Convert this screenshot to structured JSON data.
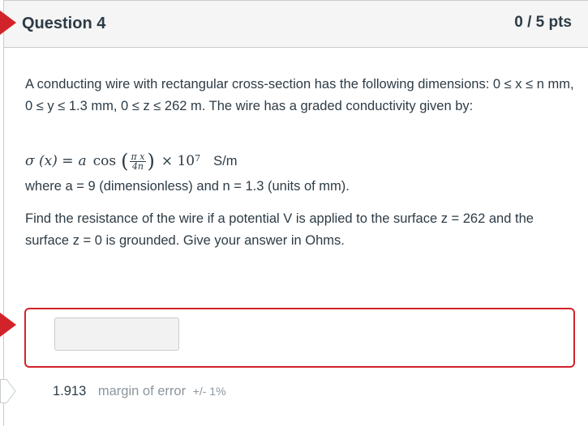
{
  "question": {
    "title": "Question 4",
    "points": "0 / 5 pts",
    "paragraph1": "A conducting wire with rectangular cross-section has the following dimensions: 0 ≤ x ≤ n mm, 0 ≤ y ≤ 1.3 mm, 0 ≤ z ≤ 262 m. The wire has a graded conductivity given by:",
    "formula": {
      "lhs": "σ (x) = ",
      "a": "a",
      "cos": "cos",
      "num": "π x",
      "den": "4n",
      "times": "× 10",
      "exp": "7",
      "unit": "S/m"
    },
    "paragraph2": "where a = 9 (dimensionless) and n = 1.3 (units of mm).",
    "paragraph3": "Find the resistance of the wire if a potential V is applied to the surface z = 262 and the surface z = 0 is grounded. Give your answer in Ohms."
  },
  "answer": {
    "input_value": "",
    "correct_value": "1.913",
    "margin_label": "margin of error",
    "tolerance": "+/- 1%"
  },
  "colors": {
    "accent_red": "#d2232a",
    "text": "#2d3b45",
    "muted": "#8b969e",
    "header_bg": "#f5f5f5"
  }
}
